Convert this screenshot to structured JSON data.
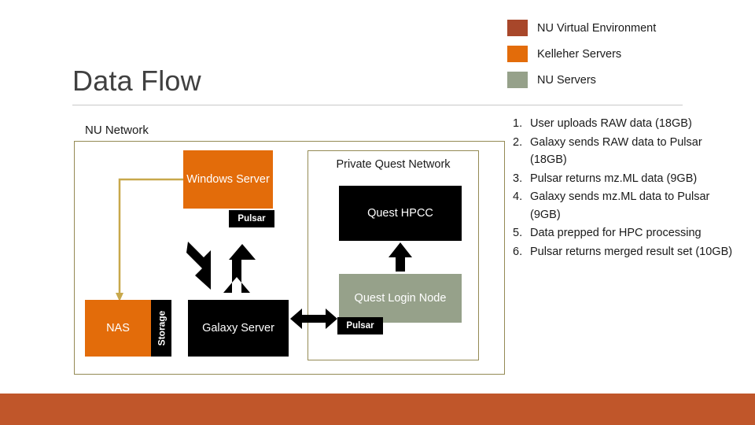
{
  "slide": {
    "title": "Data Flow",
    "bottom_bar_color": "#c0562a"
  },
  "legend": {
    "items": [
      {
        "label": "NU Virtual Environment",
        "color": "#a8472a"
      },
      {
        "label": "Kelleher Servers",
        "color": "#e36c0a"
      },
      {
        "label": "NU Servers",
        "color": "#96a18a"
      }
    ]
  },
  "steps": [
    {
      "num": "1.",
      "text": "User uploads RAW data (18GB)"
    },
    {
      "num": "2.",
      "text": "Galaxy sends RAW data to Pulsar (18GB)"
    },
    {
      "num": "3.",
      "text": "Pulsar returns mz.ML data (9GB)"
    },
    {
      "num": "4.",
      "text": "Galaxy sends mz.ML data to Pulsar (9GB)"
    },
    {
      "num": "5.",
      "text": "Data prepped for HPC processing"
    },
    {
      "num": "6.",
      "text": "Pulsar returns merged result set (10GB)"
    }
  ],
  "diagram": {
    "nu_network_label": "NU Network",
    "private_network_label": "Private Quest Network",
    "nodes": {
      "windows_server": "Windows Server",
      "pulsar_top": "Pulsar",
      "nas": "NAS",
      "storage": "Storage",
      "galaxy_server": "Galaxy Server",
      "quest_hpcc": "Quest HPCC",
      "quest_login_node": "Quest Login Node",
      "pulsar_bottom": "Pulsar"
    },
    "colors": {
      "kelleher_orange": "#e36c0a",
      "black": "#000000",
      "nu_server_green": "#96a18a",
      "network_border": "#948a54",
      "nas_arrow": "#c8a84b"
    }
  }
}
